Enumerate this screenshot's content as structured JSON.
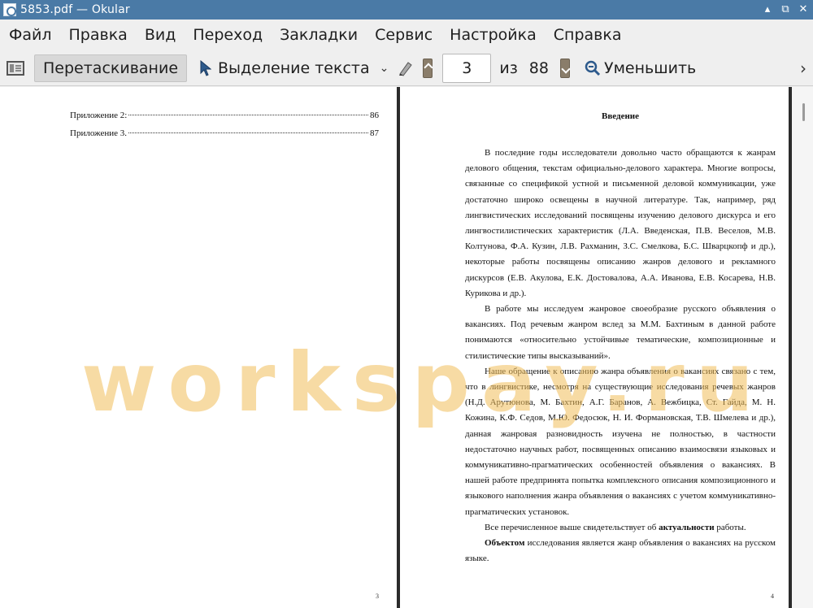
{
  "window": {
    "title": "5853.pdf  — Okular",
    "buttons": [
      "minimize",
      "maximize",
      "close"
    ]
  },
  "menu": [
    "Файл",
    "Правка",
    "Вид",
    "Переход",
    "Закладки",
    "Сервис",
    "Настройка",
    "Справка"
  ],
  "toolbar": {
    "drag_label": "Перетаскивание",
    "select_label": "Выделение текста",
    "page_current": "3",
    "page_of": "из",
    "page_total": "88",
    "zoom_out_label": "Уменьшить"
  },
  "left_page": {
    "toc": [
      {
        "title": "Приложение 2:",
        "page": "86"
      },
      {
        "title": "Приложение 3.",
        "page": "87"
      }
    ],
    "page_number": "3"
  },
  "right_page": {
    "heading": "Введение",
    "paragraphs": [
      "В последние годы исследователи довольно часто обращаются к жанрам делового общения, текстам официально-делового характера. Многие вопросы, связанные со спецификой устной и письменной деловой коммуникации, уже достаточно широко освещены в научной литературе. Так, например, ряд лингвистических исследований посвящены изучению делового дискурса и его лингвостилистических характеристик (Л.А. Введенская, П.В. Веселов, М.В. Колтунова, Ф.А. Кузин, Л.В. Рахманин, З.С. Смелкова, Б.С. Шварцкопф и др.), некоторые работы посвящены описанию жанров делового и рекламного дискурсов  (Е.В. Акулова, Е.К. Достовалова, А.А. Иванова, Е.В. Косарева, Н.В. Курикова и др.).",
      "В работе мы исследуем  жанровое своеобразие русского объявления о вакансиях. Под речевым жанром вслед за М.М. Бахтиным в данной работе понимаются «относительно устойчивые тематические, композиционные и стилистические типы высказываний».",
      "Наше обращение к описанию жанра объявления о вакансиях связано с тем, что в лингвистике, несмотря на существующие исследования речевых жанров (Н.Д. Арутюнова, М. Бахтин, А.Г. Баранов, А. Вежбицка, Ст. Гайда, М. Н. Кожина, К.Ф. Седов, М.Ю. Федосюк, Н. И. Формановская, Т.В. Шмелева и др.), данная жанровая разновидность изучена не полностью, в частности недостаточно научных работ, посвященных описанию взаимосвязи языковых и коммуникативно-прагматических особенностей объявления о вакансиях. В нашей работе предпринята попытка комплексного описания композиционного и языкового наполнения жанра объявления о вакансиях с учетом коммуникативно-прагматических установок."
    ],
    "p4_prefix": "Все перечисленное выше свидетельствует об ",
    "p4_bold": "актуальности",
    "p4_suffix": " работы.",
    "p5_bold": "Объектом",
    "p5_rest": " исследования является жанр объявления о вакансиях на русском языке.",
    "page_number": "4"
  },
  "watermark": "workspay.ru",
  "colors": {
    "titlebar": "#4a7aa6",
    "watermark": "#f0be5a"
  }
}
